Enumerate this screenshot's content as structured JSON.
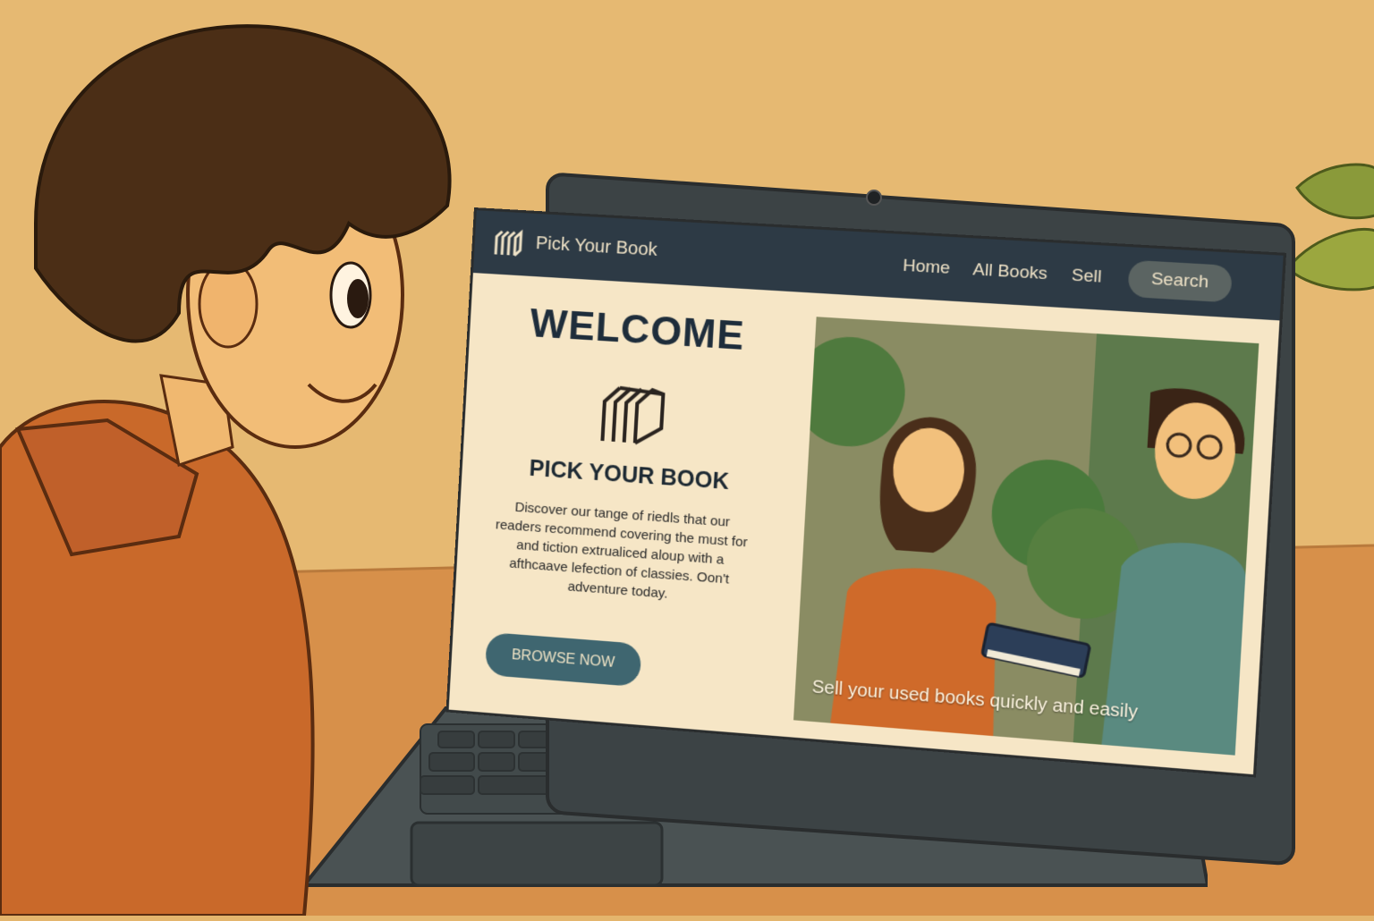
{
  "site": {
    "brand": "Pick Your Book",
    "nav": {
      "home": "Home",
      "all_books": "All Books",
      "sell": "Sell",
      "search": "Search"
    }
  },
  "hero": {
    "welcome": "WELCOME",
    "title": "PICK YOUR BOOK",
    "description": "Discover our tange of riedls that our readers recommend covering the must for and tiction extrualiced aloup with a afthcaave lefection of classies. Oon't adventure today.",
    "cta": "BROWSE NOW",
    "image_caption": "Sell your used books quickly and easily"
  },
  "colors": {
    "nav_bg": "#2d3a45",
    "page_bg": "#f6e6c6",
    "cta_bg": "#3f6670",
    "heading": "#1e2d3b"
  },
  "icons": [
    "book-logo-icon",
    "camera-icon"
  ]
}
